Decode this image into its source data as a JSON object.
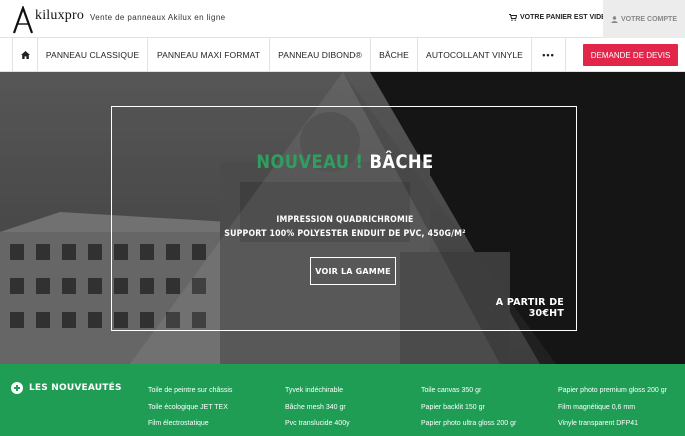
{
  "header": {
    "logo_text": "kiluxpro",
    "tagline": "Vente de panneaux Akilux en ligne",
    "cart_label": "VOTRE PANIER EST VIDE",
    "account_label": "VOTRE COMPTE"
  },
  "nav": {
    "home_icon": "home-icon",
    "items": [
      "PANNEAU CLASSIQUE",
      "PANNEAU MAXI FORMAT",
      "PANNEAU DIBOND®",
      "BÂCHE",
      "AUTOCOLLANT VINYLE"
    ],
    "more_label": "•••",
    "cta_label": "DEMANDE DE DEVIS"
  },
  "hero": {
    "title_accent": "NOUVEAU !",
    "title_main": "BÂCHE",
    "line1": "IMPRESSION QUADRICHROMIE",
    "line2": "SUPPORT 100% POLYESTER ENDUIT DE PVC, 450G/M²",
    "button_label": "VOIR LA GAMME",
    "price": "A PARTIR DE 30€HT"
  },
  "new_items": {
    "title": "LES NOUVEAUTÉS",
    "columns": [
      [
        "Toile de peintre sur châssis",
        "Toile écologique JET TEX",
        "Film électrostatique"
      ],
      [
        "Tyvek indéchirable",
        "Bâche mesh 340 gr",
        "Pvc translucide 400y"
      ],
      [
        "Toile canvas 350 gr",
        "Papier backlit 150 gr",
        "Papier photo ultra gloss 200 gr"
      ],
      [
        "Papier photo premium gloss 200 gr",
        "Film magnétique 0,6 mm",
        "Vinyle transparent DFP41"
      ]
    ]
  },
  "colors": {
    "accent_red": "#e2264a",
    "brand_green": "#1f9d55",
    "title_green": "#2f9e5e"
  }
}
